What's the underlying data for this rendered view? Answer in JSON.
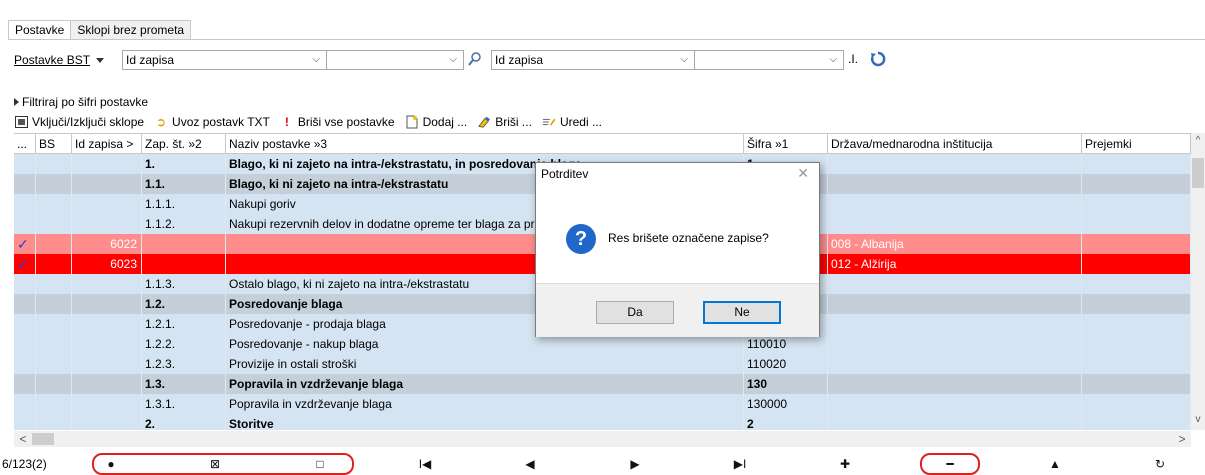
{
  "tabs": [
    "Postavke",
    "Sklopi brez prometa"
  ],
  "filter": {
    "link": "Postavke BST",
    "combo1": "Id zapisa",
    "combo3": "Id zapisa",
    "i_text": ".I."
  },
  "filter_link": "Filtriraj po šifri postavke",
  "toolbar": {
    "include": "Vključi/Izključi sklope",
    "import": "Uvoz postavk TXT",
    "delete_all": "Briši vse postavke",
    "add": "Dodaj ...",
    "delete": "Briši ...",
    "edit": "Uredi ..."
  },
  "columns": [
    "...",
    "BS",
    "Id zapisa >",
    "Zap. št. »2",
    "Naziv postavke »3",
    "Šifra »1",
    "Država/mednarodna inštitucija",
    "Prejemki"
  ],
  "rows": [
    {
      "style": "blue",
      "sel": "",
      "id": "",
      "zap": "1.",
      "naziv": "Blago, ki ni zajeto na intra-/ekstrastatu, in posredovanje blaga",
      "sifra": "1",
      "drz": "",
      "bold": true
    },
    {
      "style": "grey",
      "sel": "",
      "id": "",
      "zap": "1.1.",
      "naziv": "Blago, ki ni zajeto na intra-/ekstrastatu",
      "sifra": "",
      "drz": "",
      "bold": true
    },
    {
      "style": "blue",
      "sel": "",
      "id": "",
      "zap": "1.1.1.",
      "naziv": "Nakupi goriv",
      "sifra": "",
      "drz": "",
      "bold": false
    },
    {
      "style": "blue",
      "sel": "",
      "id": "",
      "zap": "1.1.2.",
      "naziv": "Nakupi rezervnih delov in dodatne opreme ter blaga za pr",
      "sifra": "",
      "drz": "",
      "bold": false
    },
    {
      "style": "pink",
      "sel": "✓",
      "id": "6022",
      "zap": "",
      "naziv": "",
      "sifra": "",
      "drz": "008 - Albanija",
      "bold": false
    },
    {
      "style": "red",
      "sel": "✓",
      "id": "6023",
      "zap": "",
      "naziv": "",
      "sifra": "",
      "drz": "012 - Alžirija",
      "bold": false
    },
    {
      "style": "blue",
      "sel": "",
      "id": "",
      "zap": "1.1.3.",
      "naziv": "Ostalo blago, ki ni zajeto na intra-/ekstrastatu",
      "sifra": "",
      "drz": "",
      "bold": false
    },
    {
      "style": "grey",
      "sel": "",
      "id": "",
      "zap": "1.2.",
      "naziv": "Posredovanje blaga",
      "sifra": "",
      "drz": "",
      "bold": true
    },
    {
      "style": "blue",
      "sel": "",
      "id": "",
      "zap": "1.2.1.",
      "naziv": "Posredovanje - prodaja blaga",
      "sifra": "",
      "drz": "",
      "bold": false
    },
    {
      "style": "blue",
      "sel": "",
      "id": "",
      "zap": "1.2.2.",
      "naziv": "Posredovanje - nakup blaga",
      "sifra": "110010",
      "drz": "",
      "bold": false
    },
    {
      "style": "blue",
      "sel": "",
      "id": "",
      "zap": "1.2.3.",
      "naziv": "Provizije in ostali stroški",
      "sifra": "110020",
      "drz": "",
      "bold": false
    },
    {
      "style": "grey",
      "sel": "",
      "id": "",
      "zap": "1.3.",
      "naziv": "Popravila in vzdrževanje blaga",
      "sifra": "130",
      "drz": "",
      "bold": true
    },
    {
      "style": "blue",
      "sel": "",
      "id": "",
      "zap": "1.3.1.",
      "naziv": "Popravila in vzdrževanje blaga",
      "sifra": "130000",
      "drz": "",
      "bold": false
    },
    {
      "style": "blue",
      "sel": "",
      "id": "",
      "zap": "2.",
      "naziv": "Storitve",
      "sifra": "2",
      "drz": "",
      "bold": true
    }
  ],
  "nav": {
    "counter": "6/123(2)",
    "buttons": [
      "●",
      "⊠",
      "□",
      "I◀",
      "◀",
      "▶",
      "▶I",
      "✚",
      "━",
      "▲",
      "↻"
    ]
  },
  "dialog": {
    "title": "Potrditev",
    "close": "✕",
    "icon": "?",
    "message": "Res brišete označene zapise?",
    "yes": "Da",
    "no": "Ne"
  },
  "colors": {
    "row_blue": "#d5e4f2",
    "row_grey": "#c4cfd9",
    "row_selected": "#ff8c8c",
    "row_current": "#ff0000",
    "highlight_circle": "#e02020",
    "dialog_icon": "#1f67c8"
  }
}
